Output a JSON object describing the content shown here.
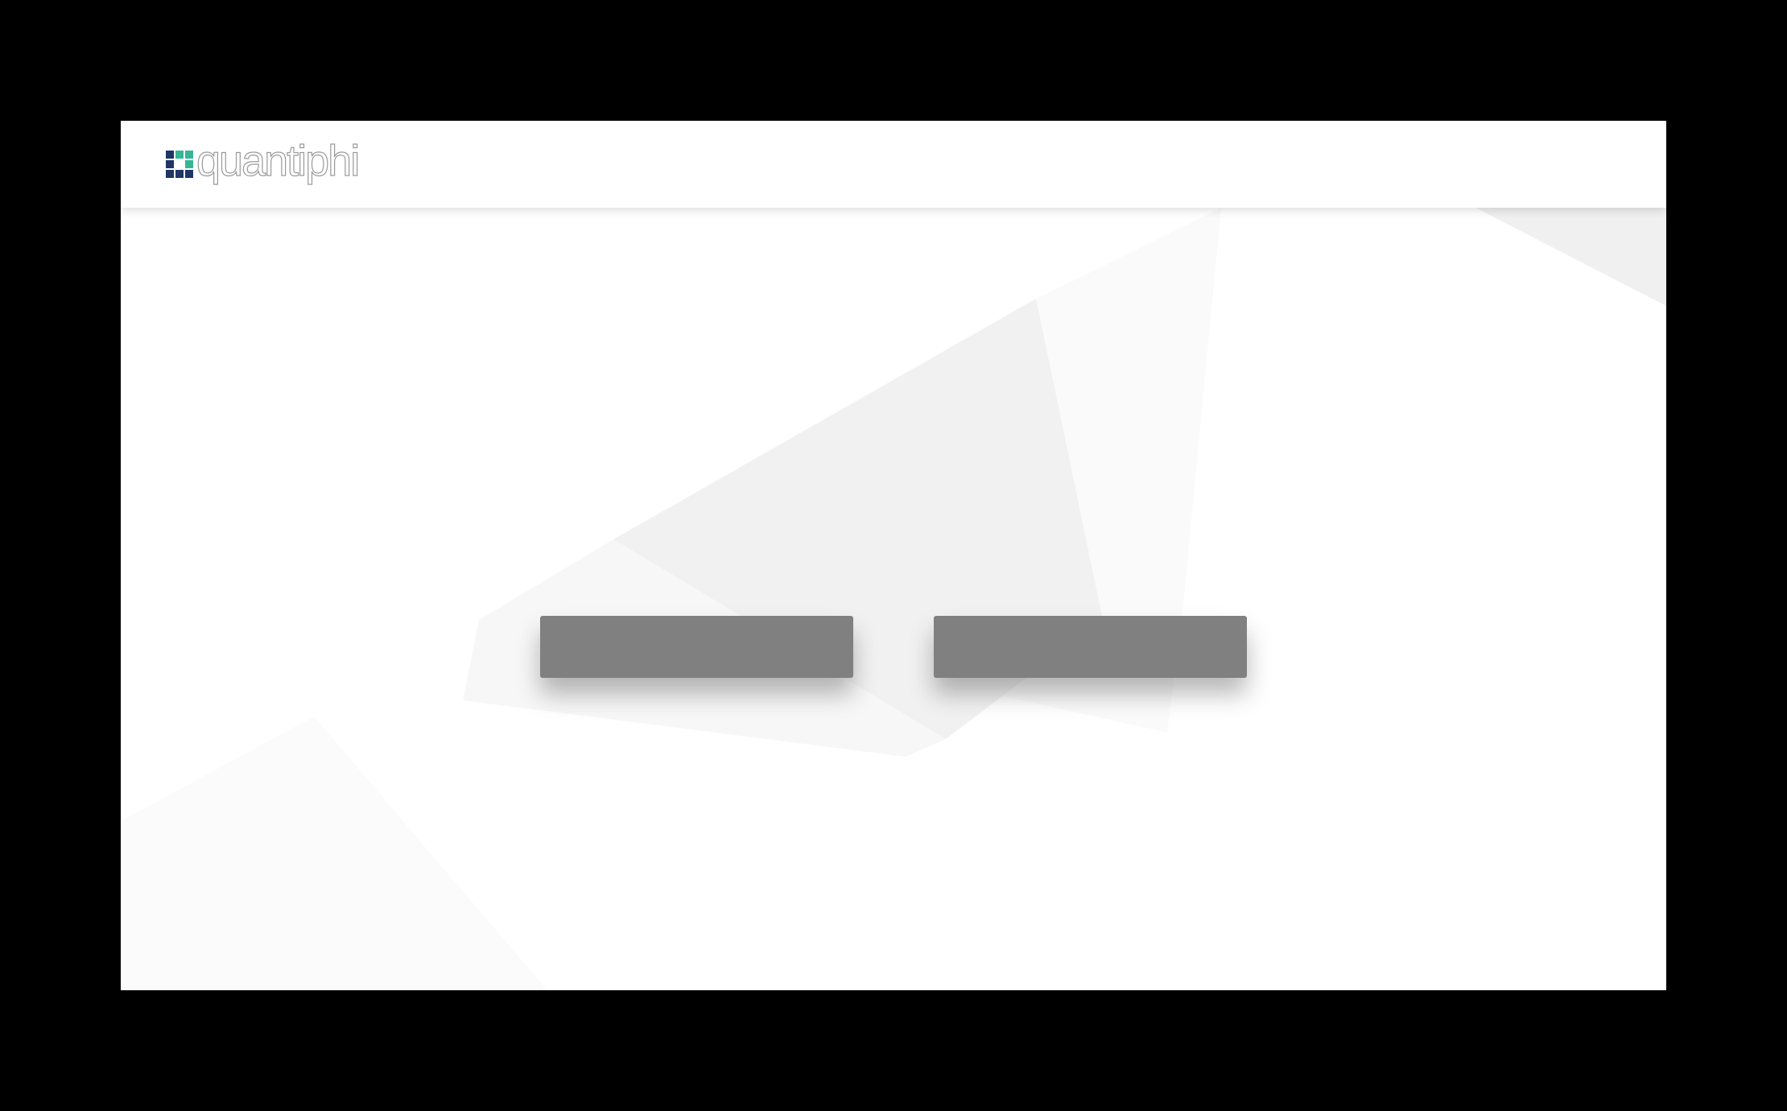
{
  "brand": {
    "name": "quantiphi",
    "logo_colors": {
      "navy": "#1f3566",
      "teal": "#37b597",
      "light": "#ffffff"
    }
  },
  "actions": {
    "left_label": "",
    "right_label": ""
  },
  "colors": {
    "background": "#ffffff",
    "outer_frame": "#000000",
    "button_fill": "#808080"
  }
}
